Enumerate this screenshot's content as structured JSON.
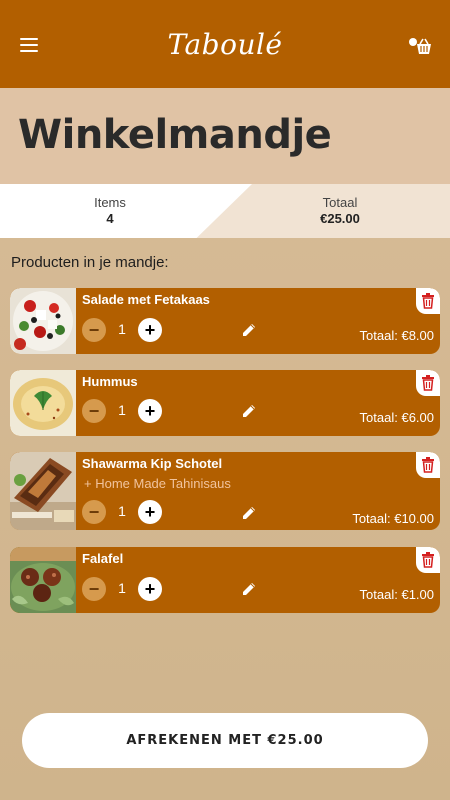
{
  "header": {
    "logo": "Taboulé",
    "menu_icon": "hamburger-menu-icon",
    "basket_icon": "shopping-basket-icon",
    "brand_color": "#b25f00"
  },
  "page_title": "Winkelmandje",
  "summary": {
    "items_label": "Items",
    "items_value": "4",
    "total_label": "Totaal",
    "total_value": "€25.00"
  },
  "section_label": "Producten in je mandje:",
  "cart": {
    "items": [
      {
        "name": "Salade met Fetakaas",
        "extra": "",
        "quantity": "1",
        "total": "Totaal: €8.00",
        "image": "salad-photo"
      },
      {
        "name": "Hummus",
        "extra": "",
        "quantity": "1",
        "total": "Totaal: €6.00",
        "image": "hummus-photo"
      },
      {
        "name": "Shawarma Kip Schotel",
        "extra": "+ Home Made Tahinisaus",
        "quantity": "1",
        "total": "Totaal: €10.00",
        "image": "shawarma-photo"
      },
      {
        "name": "Falafel",
        "extra": "",
        "quantity": "1",
        "total": "Totaal: €1.00",
        "image": "falafel-photo"
      }
    ],
    "minus_label": "−",
    "plus_label": "+",
    "edit_icon": "pencil-icon",
    "delete_icon": "trash-icon"
  },
  "checkout": {
    "label": "AFREKENEN MET €25.00"
  }
}
